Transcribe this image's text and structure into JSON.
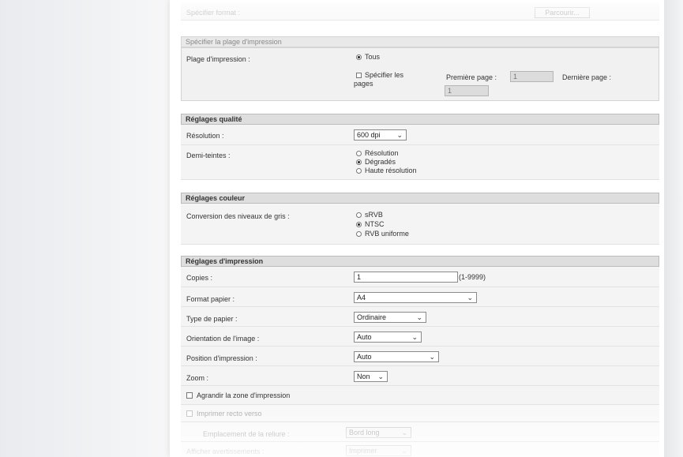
{
  "top": {
    "format_label": "Spécifier format :",
    "browse_label": "Parcourir..."
  },
  "print_range": {
    "header": "Spécifier la plage d'impression",
    "label": "Plage d'impression :",
    "option_all": "Tous",
    "option_pages_line1": "Spécifier les",
    "option_pages_line2": "pages",
    "first_page_label": "Première page :",
    "first_page_value": "1",
    "last_page_label": "Dernière page :",
    "last_page_value": "1"
  },
  "quality": {
    "header": "Réglages qualité",
    "resolution_label": "Résolution :",
    "resolution_value": "600 dpi",
    "halftone_label": "Demi-teintes :",
    "halftone_options": [
      "Résolution",
      "Dégradés",
      "Haute résolution"
    ],
    "halftone_selected": "Dégradés"
  },
  "color": {
    "header": "Réglages couleur",
    "gray_label": "Conversion des niveaux de gris :",
    "gray_options": [
      "sRVB",
      "NTSC",
      "RVB uniforme"
    ],
    "gray_selected": "NTSC"
  },
  "print_settings": {
    "header": "Réglages d'impression",
    "copies_label": "Copies :",
    "copies_value": "1",
    "copies_range": "(1-9999)",
    "paper_format_label": "Format papier :",
    "paper_format_value": "A4",
    "paper_type_label": "Type de papier :",
    "paper_type_value": "Ordinaire",
    "orientation_label": "Orientation de l'image :",
    "orientation_value": "Auto",
    "position_label": "Position d'impression :",
    "position_value": "Auto",
    "zoom_label": "Zoom :",
    "zoom_value": "Non",
    "enlarge_label": "Agrandir la zone d'impression",
    "duplex_label": "Imprimer recto verso",
    "binding_label": "Emplacement de la reliure :",
    "binding_value": "Bord long",
    "warnings_label": "Afficher avertissements :",
    "warnings_value": "Imprimer"
  }
}
